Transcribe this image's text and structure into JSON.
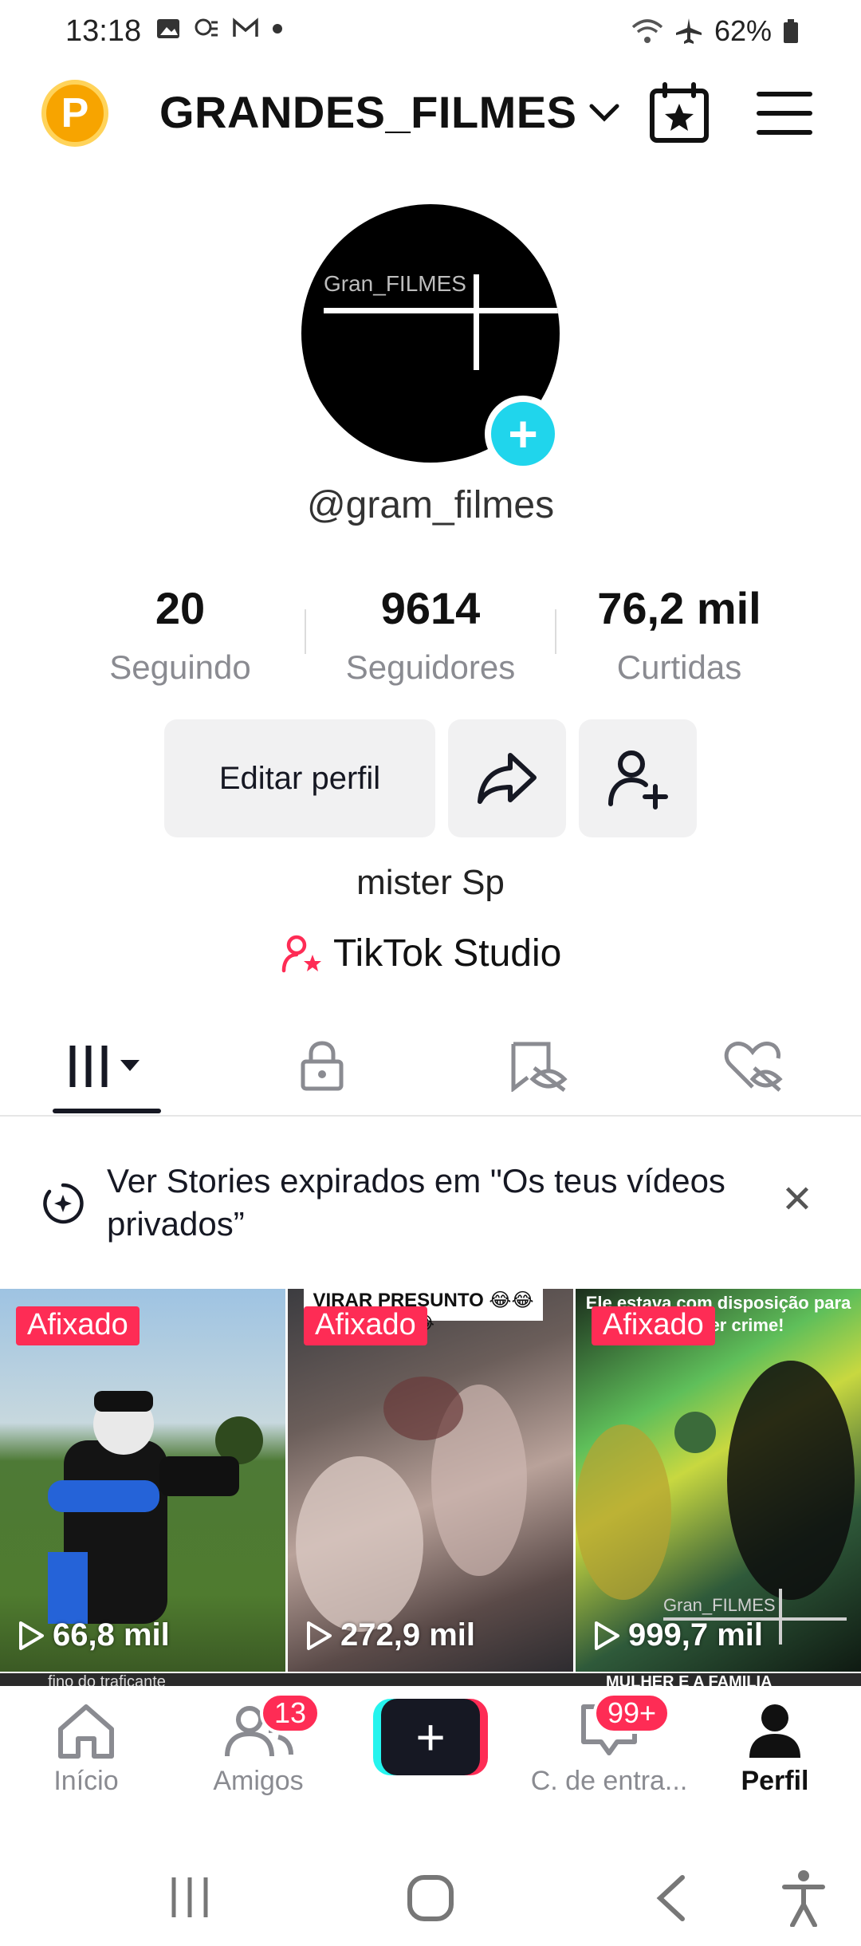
{
  "status_bar": {
    "time": "13:18",
    "battery": "62%"
  },
  "header": {
    "coin_letter": "P",
    "account_name": "GRANDES_FILMES",
    "icons": [
      "calendar-star-icon",
      "hamburger-menu-icon"
    ]
  },
  "profile": {
    "avatar_text": "Gran_FILMES",
    "handle": "@gram_filmes",
    "stats": [
      {
        "value": "20",
        "label": "Seguindo"
      },
      {
        "value": "9614",
        "label": "Seguidores"
      },
      {
        "value": "76,2 mil",
        "label": "Curtidas"
      }
    ],
    "edit_button": "Editar perfil",
    "bio": "mister Sp",
    "studio_link": "TikTok Studio"
  },
  "tabs": [
    "videos-grid-icon",
    "lock-icon",
    "eye-off-icon",
    "liked-hidden-icon"
  ],
  "banner": {
    "text": "Ver Stories expirados em \"Os teus vídeos privados”"
  },
  "videos": [
    {
      "badge": "Afixado",
      "views": "66,8 mil",
      "caption": ""
    },
    {
      "badge": "Afixado",
      "views": "272,9 mil",
      "caption": "VIRAR PRESUNTO 😂😂😂"
    },
    {
      "badge": "Afixado",
      "views": "999,7 mil",
      "caption": "Ele estava com disposição para qualquer crime!",
      "watermark": "Gran_FILMES"
    }
  ],
  "row2_captions": [
    "fino do traficante",
    "MULHER E A FAMILIA"
  ],
  "bottom_nav": {
    "home": "Início",
    "friends": "Amigos",
    "friends_badge": "13",
    "inbox": "C. de entra...",
    "inbox_badge": "99+",
    "profile": "Perfil"
  },
  "colors": {
    "accent": "#fe2c55",
    "cyan": "#25f4ee",
    "text": "#161823",
    "muted": "#8a8b91"
  }
}
